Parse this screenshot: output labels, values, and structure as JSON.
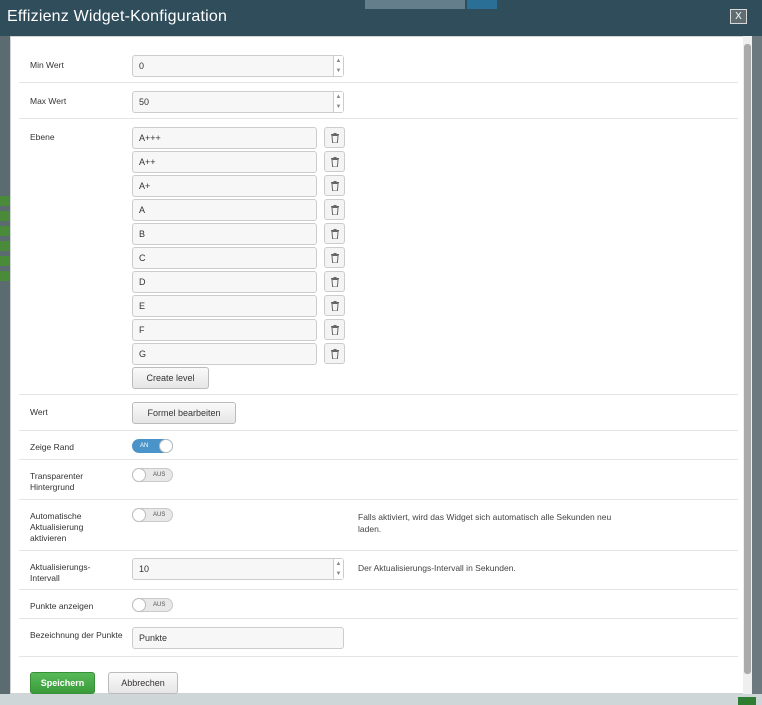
{
  "dialog": {
    "title": "Effizienz Widget-Konfiguration",
    "close_label": "X"
  },
  "fields": {
    "min_label": "Min Wert",
    "min_value": "0",
    "max_label": "Max Wert",
    "max_value": "50",
    "ebene_label": "Ebene",
    "levels": [
      "A+++",
      "A++",
      "A+",
      "A",
      "B",
      "C",
      "D",
      "E",
      "F",
      "G"
    ],
    "create_level_label": "Create level",
    "wert_label": "Wert",
    "formula_button_label": "Formel bearbeiten",
    "zeige_rand_label": "Zeige Rand",
    "zeige_rand_state": "AN",
    "transparent_label": "Transparenter Hintergrund",
    "transparent_state": "AUS",
    "auto_update_label": "Automatische Aktualisierung aktivieren",
    "auto_update_state": "AUS",
    "auto_update_help": "Falls aktiviert, wird das Widget sich automatisch alle Sekunden neu laden.",
    "interval_label": "Aktualisierungs-Intervall",
    "interval_value": "10",
    "interval_help": "Der Aktualisierungs-Intervall in Sekunden.",
    "points_show_label": "Punkte anzeigen",
    "points_show_state": "AUS",
    "points_name_label": "Bezeichnung der Punkte",
    "points_name_value": "Punkte"
  },
  "footer": {
    "save_label": "Speichern",
    "cancel_label": "Abbrechen"
  },
  "icons": {
    "delete": "trash-icon",
    "close": "close-icon",
    "spin_up": "chevron-up-icon",
    "spin_down": "chevron-down-icon"
  },
  "colors": {
    "save": "#4cae4c",
    "toggle_on": "#4b94c9",
    "title_bar": "#3f4f57"
  }
}
